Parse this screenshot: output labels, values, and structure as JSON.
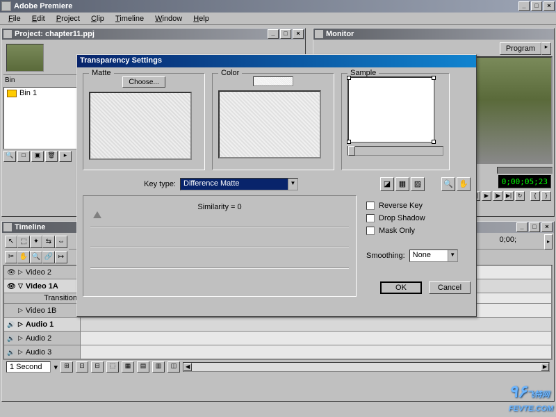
{
  "app": {
    "title": "Adobe Premiere",
    "menu": [
      "File",
      "Edit",
      "Project",
      "Clip",
      "Timeline",
      "Window",
      "Help"
    ]
  },
  "project": {
    "title": "Project: chapter11.ppj",
    "bin_label": "Bin",
    "bin_items": [
      "Bin 1"
    ]
  },
  "monitor": {
    "title": "Monitor",
    "tab": "Program",
    "timecode": "0;00;05;23"
  },
  "timeline": {
    "title": "Timeline",
    "ruler_mark": "0;00;",
    "tracks": {
      "video2": "Video 2",
      "video1a": "Video 1A",
      "transition": "Transition",
      "video1b": "Video 1B",
      "audio1": "Audio 1",
      "audio2": "Audio 2",
      "audio3": "Audio 3"
    },
    "zoom": "1 Second"
  },
  "dialog": {
    "title": "Transparency Settings",
    "matte_label": "Matte",
    "choose_btn": "Choose...",
    "color_label": "Color",
    "sample_label": "Sample",
    "key_type_label": "Key type:",
    "key_type_value": "Difference Matte",
    "similarity_label": "Similarity = 0",
    "reverse_key": "Reverse Key",
    "drop_shadow": "Drop Shadow",
    "mask_only": "Mask Only",
    "smoothing_label": "Smoothing:",
    "smoothing_value": "None",
    "ok": "OK",
    "cancel": "Cancel"
  },
  "watermark": {
    "text": "飞特网",
    "sub": "FEVTE.COM"
  }
}
